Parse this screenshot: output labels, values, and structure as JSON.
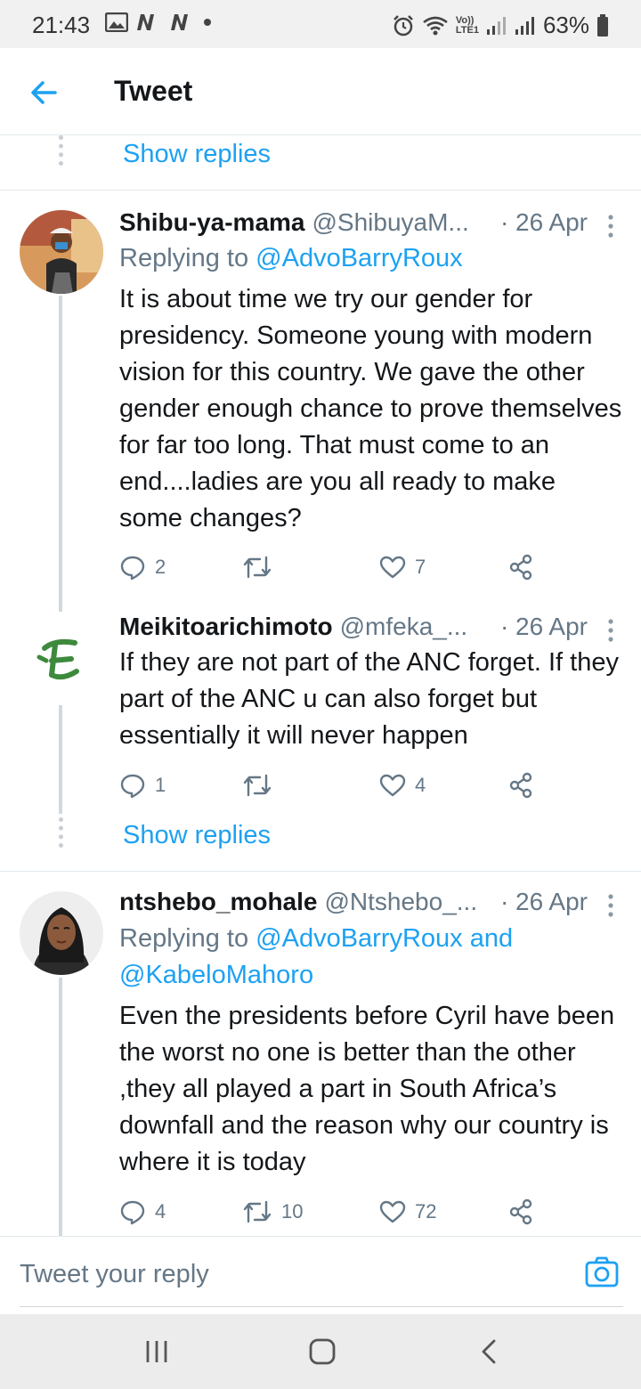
{
  "status_bar": {
    "time": "21:43",
    "battery": "63%",
    "network_label": "LTE1"
  },
  "header": {
    "title": "Tweet",
    "back_icon": "arrow-left-icon"
  },
  "thread": {
    "show_replies_top": "Show replies",
    "show_replies_mid": "Show replies"
  },
  "tweets": [
    {
      "name": "Shibu-ya-mama",
      "handle": "@ShibuyaM...",
      "date": "· 26 Apr",
      "replying_prefix": "Replying to ",
      "replying_mentions": "@AdvoBarryRoux",
      "replying_mentions_2": "",
      "text": "It is about time we try our gender for presidency. Someone young with modern vision for this country. We gave the other gender enough chance to prove themselves for far too long. That must come to an end....ladies are you all ready to make some changes?",
      "replies": "2",
      "retweets": "",
      "likes": "7"
    },
    {
      "name": "Meikitoarichimoto",
      "handle": "@mfeka_...",
      "date": "· 26 Apr",
      "text": "If they are not part of the ANC forget. If they part of the ANC u can also forget but essentially it will never happen",
      "replies": "1",
      "retweets": "",
      "likes": "4"
    },
    {
      "name": "ntshebo_mohale",
      "handle": "@Ntshebo_...",
      "date": "· 26 Apr",
      "replying_prefix": "Replying to ",
      "replying_mentions": "@AdvoBarryRoux and",
      "replying_mentions_2": "@KabeloMahoro",
      "text": "Even the presidents before Cyril have been the worst no one is better than the other ,they all played a part in South Africa’s downfall and the reason why our country is where it is today",
      "replies": "4",
      "retweets": "10",
      "likes": "72"
    }
  ],
  "reply_bar": {
    "placeholder": "Tweet your reply"
  },
  "colors": {
    "accent": "#1da1f2",
    "secondary_text": "#657786",
    "border": "#e1e8ed"
  }
}
